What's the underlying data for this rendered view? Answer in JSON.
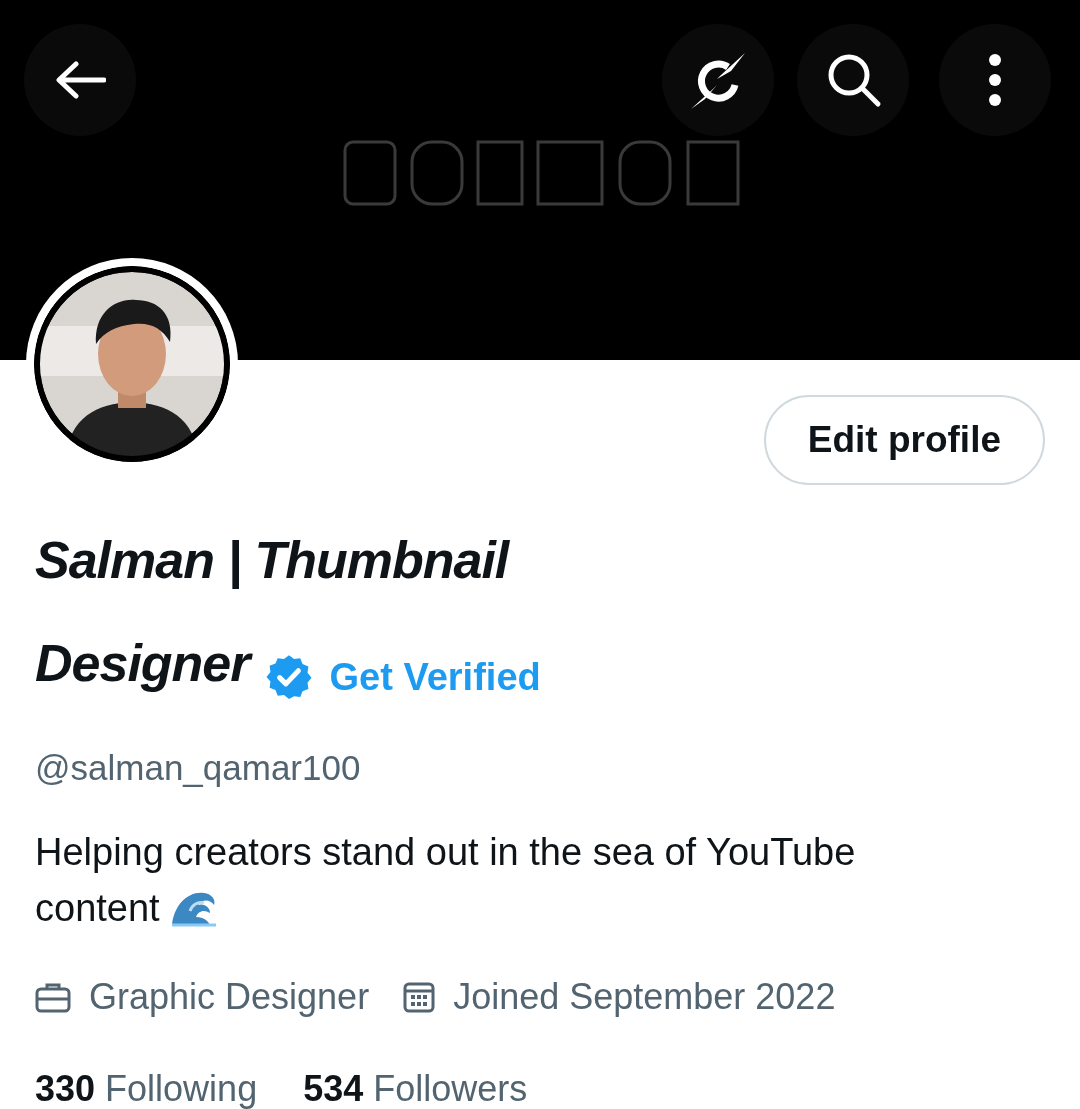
{
  "edit_button": {
    "label": "Edit profile"
  },
  "profile": {
    "name_lines": [
      "Salman | Thumbnail",
      "Designer"
    ],
    "verified": true,
    "get_verified": "Get Verified",
    "handle": "@salman_qamar100",
    "bio_lines": [
      "Helping creators stand out in the sea of YouTube",
      "content"
    ]
  },
  "meta": [
    {
      "kind": "work",
      "text": "Graphic Designer"
    },
    {
      "kind": "joined",
      "text": "Joined September 2022"
    }
  ],
  "stats": [
    {
      "count": "330",
      "label": "Following"
    },
    {
      "count": "534",
      "label": "Followers"
    }
  ]
}
